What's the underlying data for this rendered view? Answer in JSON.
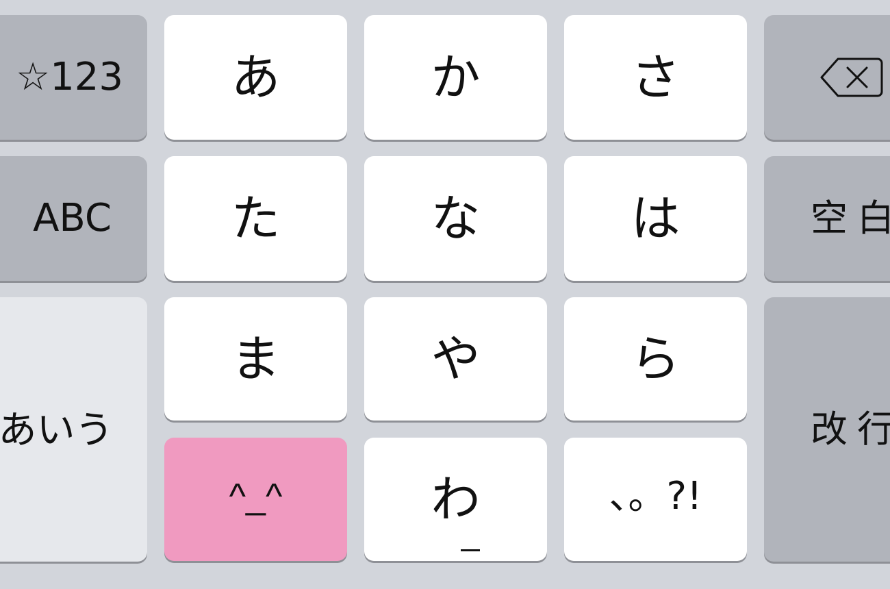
{
  "keyboard": {
    "left_column": {
      "symbols_key": "☆123",
      "abc_key": "ABC",
      "hiragana_key": "あいう"
    },
    "kana_grid": {
      "a": "あ",
      "ka": "か",
      "sa": "さ",
      "ta": "た",
      "na": "な",
      "ha": "は",
      "ma": "ま",
      "ya": "や",
      "ra": "ら",
      "emoticon": "^_^",
      "wa": "わ",
      "punctuation": "、。?!"
    },
    "right_column": {
      "backspace_icon": "backspace-icon",
      "space_key": "空白",
      "enter_key": "改行"
    },
    "colors": {
      "background": "#d2d5db",
      "letter_key": "#ffffff",
      "function_key": "#b1b4bb",
      "hiragana_key": "#e6e8ec",
      "emoticon_key": "#f09ac0"
    }
  }
}
